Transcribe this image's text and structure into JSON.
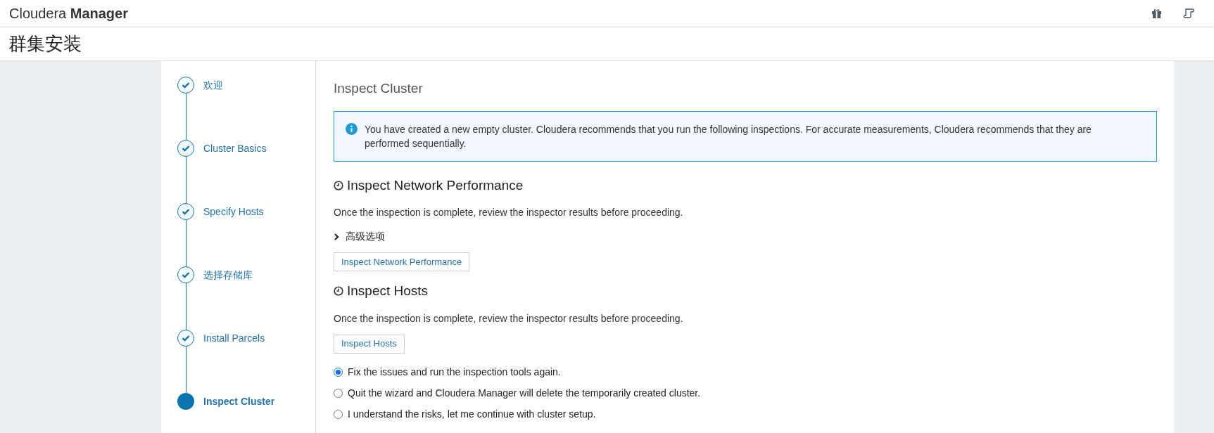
{
  "header": {
    "brand_light": "Cloudera",
    "brand_bold": "Manager"
  },
  "page_title": "群集安装",
  "steps": [
    {
      "label": "欢迎",
      "kind": "done"
    },
    {
      "label": "Cluster Basics",
      "kind": "done"
    },
    {
      "label": "Specify Hosts",
      "kind": "done"
    },
    {
      "label": "选择存储库",
      "kind": "done"
    },
    {
      "label": "Install Parcels",
      "kind": "done"
    },
    {
      "label": "Inspect Cluster",
      "kind": "current"
    }
  ],
  "main": {
    "title": "Inspect Cluster",
    "info": "You have created a new empty cluster. Cloudera recommends that you run the following inspections. For accurate measurements, Cloudera recommends that they are performed sequentially.",
    "sections": [
      {
        "heading": "Inspect Network Performance",
        "description": "Once the inspection is complete, review the inspector results before proceeding.",
        "advanced": {
          "label": "高级选项",
          "expanded": false
        },
        "button": "Inspect Network Performance"
      },
      {
        "heading": "Inspect Hosts",
        "description": "Once the inspection is complete, review the inspector results before proceeding.",
        "button": "Inspect Hosts"
      }
    ],
    "options": [
      {
        "label": "Fix the issues and run the inspection tools again.",
        "selected": true
      },
      {
        "label": "Quit the wizard and Cloudera Manager will delete the temporarily created cluster.",
        "selected": false
      },
      {
        "label": "I understand the risks, let me continue with cluster setup.",
        "selected": false
      }
    ]
  }
}
